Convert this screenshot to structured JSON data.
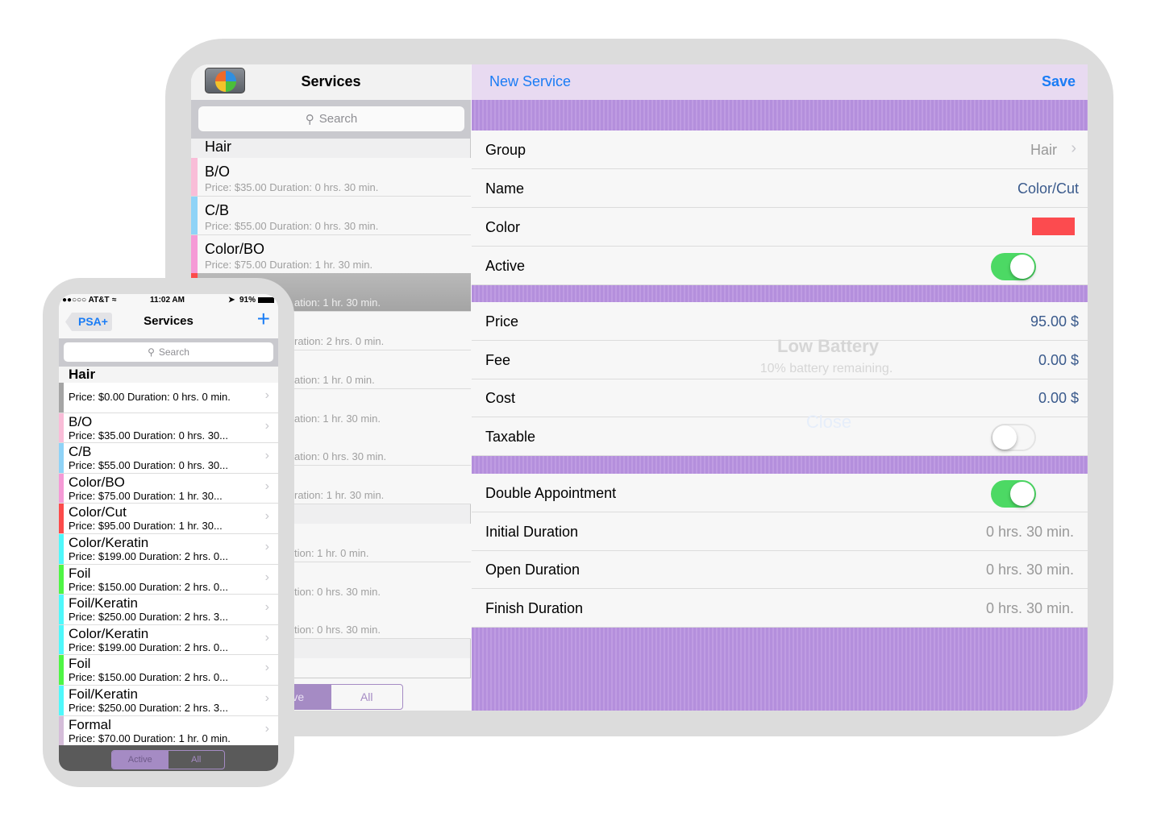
{
  "tablet": {
    "left": {
      "title": "Services",
      "search_placeholder": "Search",
      "sections": [
        {
          "label": "Hair"
        }
      ],
      "rows": [
        {
          "title": "B/O",
          "subtitle": "Price: $35.00  Duration: 0 hrs. 30 min.",
          "color": "#f9bdd8"
        },
        {
          "title": "C/B",
          "subtitle": "Price: $55.00  Duration: 0 hrs. 30 min.",
          "color": "#8fd3f7"
        },
        {
          "title": "Color/BO",
          "subtitle": "Price: $75.00  Duration: 1 hr. 30 min.",
          "color": "#f59ad6"
        }
      ],
      "partial_rows": [
        "ation: 1 hr. 30 min.",
        "ration: 2 hrs. 0 min.",
        "ation: 1 hr. 0 min.",
        "ation: 1 hr. 30 min.",
        "ation: 0 hrs. 30 min.",
        "ration: 1 hr. 30 min.",
        "tion: 1 hr. 0 min.",
        "tion: 0 hrs. 30 min.",
        "tion: 0 hrs. 30 min."
      ],
      "segments": {
        "active": "tive",
        "all": "All"
      }
    },
    "right": {
      "title": "New Service",
      "save": "Save",
      "fields": {
        "group": {
          "label": "Group",
          "value": "Hair"
        },
        "name": {
          "label": "Name",
          "value": "Color/Cut"
        },
        "color": {
          "label": "Color",
          "value": "#fc4b4f"
        },
        "active": {
          "label": "Active",
          "on": true
        },
        "price": {
          "label": "Price",
          "value": "95.00  $"
        },
        "fee": {
          "label": "Fee",
          "value": "0.00  $"
        },
        "cost": {
          "label": "Cost",
          "value": "0.00  $"
        },
        "taxable": {
          "label": "Taxable",
          "on": false
        },
        "double": {
          "label": "Double Appointment",
          "on": true
        },
        "initial": {
          "label": "Initial Duration",
          "value": "0 hrs. 30 min."
        },
        "open": {
          "label": "Open Duration",
          "value": "0 hrs. 30 min."
        },
        "finish": {
          "label": "Finish Duration",
          "value": "0 hrs. 30 min."
        }
      }
    },
    "alert": {
      "title": "Low Battery",
      "message": "10% battery remaining.",
      "button": "Close"
    }
  },
  "phone": {
    "status": {
      "carrier": "●●○○○ AT&T",
      "time": "11:02 AM",
      "battery": "91%"
    },
    "back": "PSA+",
    "title": "Services",
    "add": "+",
    "search_placeholder": "Search",
    "section": "Hair",
    "rows": [
      {
        "title": "",
        "subtitle": "Price: $0.00  Duration: 0 hrs. 0 min.",
        "color": "#a5a5a5"
      },
      {
        "title": "B/O",
        "subtitle": "Price: $35.00  Duration: 0 hrs. 30...",
        "color": "#f9bdd8"
      },
      {
        "title": "C/B",
        "subtitle": "Price: $55.00  Duration: 0 hrs. 30...",
        "color": "#8fd3f7"
      },
      {
        "title": "Color/BO",
        "subtitle": "Price: $75.00  Duration: 1 hr. 30...",
        "color": "#f59ad6"
      },
      {
        "title": "Color/Cut",
        "subtitle": "Price: $95.00  Duration: 1 hr. 30...",
        "color": "#fc4b4b"
      },
      {
        "title": "Color/Keratin",
        "subtitle": "Price: $199.00  Duration: 2 hrs. 0...",
        "color": "#4ff8fb"
      },
      {
        "title": "Foil",
        "subtitle": "Price: $150.00  Duration: 2 hrs. 0...",
        "color": "#4ff545"
      },
      {
        "title": "Foil/Keratin",
        "subtitle": "Price: $250.00  Duration: 2 hrs. 3...",
        "color": "#4ff8fb"
      },
      {
        "title": "Color/Keratin",
        "subtitle": "Price: $199.00  Duration: 2 hrs. 0...",
        "color": "#4ff8fb"
      },
      {
        "title": "Foil",
        "subtitle": "Price: $150.00  Duration: 2 hrs. 0...",
        "color": "#4ff545"
      },
      {
        "title": "Foil/Keratin",
        "subtitle": "Price: $250.00  Duration: 2 hrs. 3...",
        "color": "#4ff8fb"
      },
      {
        "title": "Formal",
        "subtitle": "Price: $70.00  Duration: 1 hr. 0 min.",
        "color": "#d5bdd9"
      }
    ],
    "segments": {
      "active": "Active",
      "all": "All"
    }
  },
  "colors": {
    "accent": "#1a7cf5",
    "purple": "#b48fdc",
    "toggle_on": "#4cd964"
  }
}
